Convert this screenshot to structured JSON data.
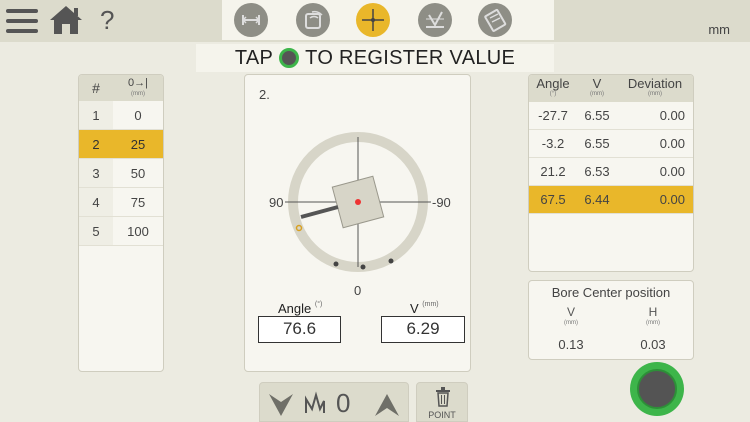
{
  "header": {
    "unit": "mm",
    "help": "?",
    "instruction_before": "TAP",
    "instruction_after": "TO REGISTER VALUE"
  },
  "positions": {
    "header_num": "#",
    "header_dist": "0→|",
    "header_dist_unit": "(mm)",
    "rows": [
      {
        "n": "1",
        "v": "0"
      },
      {
        "n": "2",
        "v": "25",
        "selected": true
      },
      {
        "n": "3",
        "v": "50"
      },
      {
        "n": "4",
        "v": "75"
      },
      {
        "n": "5",
        "v": "100"
      }
    ]
  },
  "center": {
    "point_label": "2.",
    "dial_left": "90",
    "dial_right": "-90",
    "dial_bottom": "0",
    "angle_label": "Angle",
    "angle_unit": "(°)",
    "angle_value": "76.6",
    "v_label": "V",
    "v_unit": "(mm)",
    "v_value": "6.29"
  },
  "measurements": {
    "headers": [
      {
        "label": "Angle",
        "unit": "(°)"
      },
      {
        "label": "V",
        "unit": "(mm)"
      },
      {
        "label": "Deviation",
        "unit": "(mm)"
      }
    ],
    "rows": [
      {
        "angle": "-27.7",
        "v": "6.55",
        "dev": "0.00"
      },
      {
        "angle": "-3.2",
        "v": "6.55",
        "dev": "0.00"
      },
      {
        "angle": "21.2",
        "v": "6.53",
        "dev": "0.00"
      },
      {
        "angle": "67.5",
        "v": "6.44",
        "dev": "0.00",
        "selected": true
      }
    ]
  },
  "bore_center": {
    "title": "Bore Center position",
    "v_label": "V",
    "v_unit": "(mm)",
    "v_value": "0.13",
    "h_label": "H",
    "h_unit": "(mm)",
    "h_value": "0.03"
  },
  "bottom": {
    "offset_value": "0",
    "point_label": "POINT"
  },
  "colors": {
    "accent": "#e9b72a",
    "register": "#3db54a",
    "background": "#ecebe1"
  }
}
